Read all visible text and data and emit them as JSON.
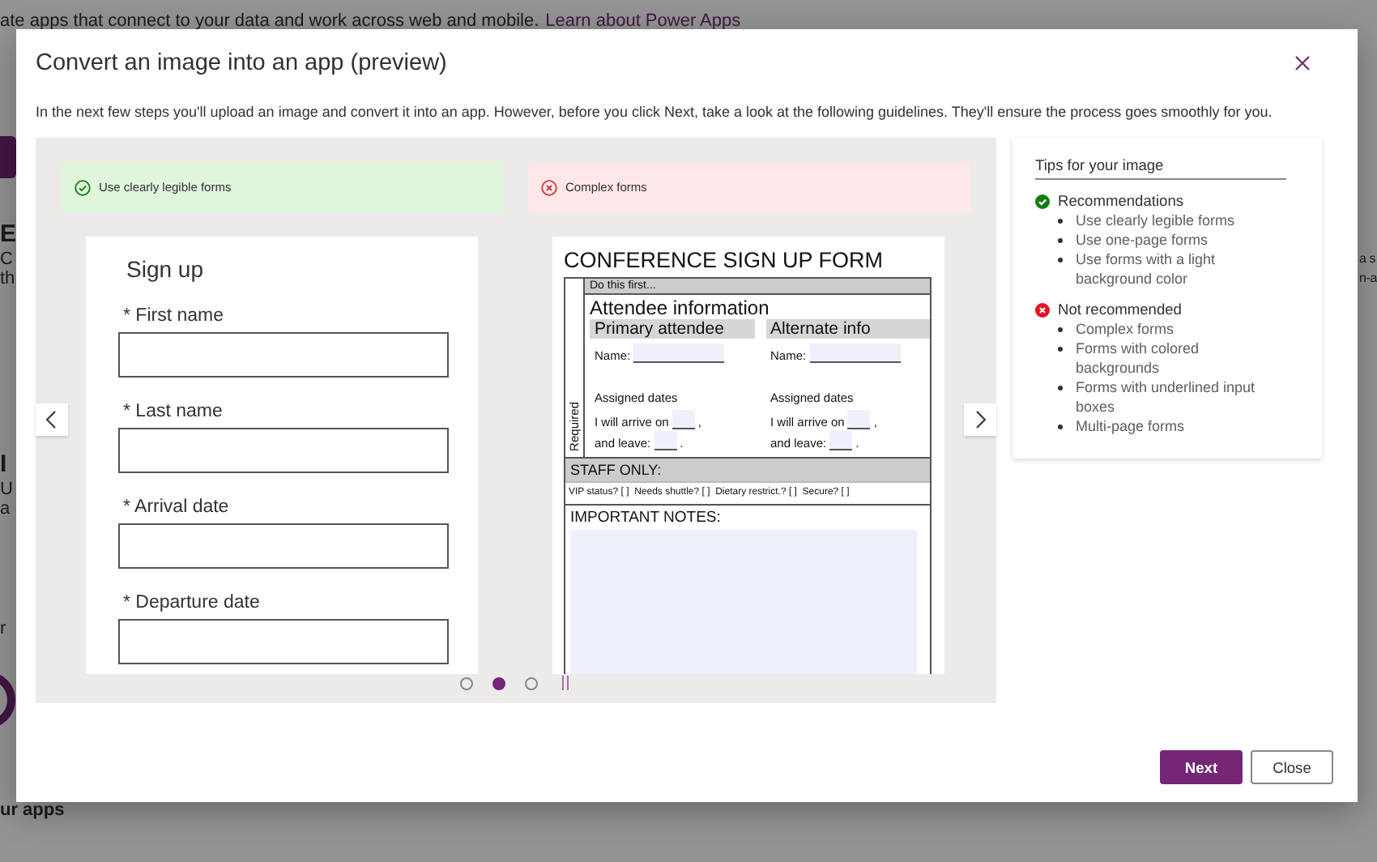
{
  "background": {
    "intro": "ate apps that connect to your data and work across web and mobile.",
    "link": "Learn about Power Apps",
    "left_fragments": [
      {
        "text": "E",
        "kind": "heading"
      },
      {
        "text": "C",
        "kind": "body"
      },
      {
        "text": "th",
        "kind": "body"
      },
      {
        "text": "I",
        "kind": "heading"
      },
      {
        "text": "U",
        "kind": "body"
      },
      {
        "text": "a",
        "kind": "body"
      },
      {
        "text": "r",
        "kind": "body"
      }
    ],
    "right_fragments": [
      "a s",
      "n-a"
    ],
    "footer": "ur apps"
  },
  "dialog": {
    "title": "Convert an image into an app (preview)",
    "description": "In the next few steps you'll upload an image and convert it into an app. However, before you click Next, take a look at the following guidelines. They'll ensure the process goes smoothly for you.",
    "examples": [
      {
        "kind": "good",
        "label": "Use clearly legible forms",
        "form": {
          "title": "Sign up",
          "fields": [
            "* First name",
            "* Last name",
            "* Arrival date",
            "* Departure date"
          ]
        }
      },
      {
        "kind": "bad",
        "label": "Complex forms",
        "form": {
          "title": "CONFERENCE SIGN UP FORM",
          "side_label": "Required",
          "banner": "Do this first...",
          "section": "Attendee information",
          "columns": [
            {
              "heading": "Primary attendee",
              "name_label": "Name:",
              "dates_heading": "Assigned dates",
              "arrive": "I will arrive on",
              "arrive_end": ",",
              "leave": "and leave:",
              "leave_end": "."
            },
            {
              "heading": "Alternate info",
              "name_label": "Name:",
              "dates_heading": "Assigned dates",
              "arrive": "I will arrive on",
              "arrive_end": ",",
              "leave": "and leave:",
              "leave_end": "."
            }
          ],
          "staff_heading": "STAFF ONLY:",
          "staff_items": "VIP status? [ ]  Needs shuttle? [ ]  Dietary restrict.? [ ]  Secure? [ ]",
          "notes_heading": "IMPORTANT NOTES:"
        }
      }
    ],
    "pager": [
      {
        "selected": false
      },
      {
        "selected": true
      },
      {
        "selected": false
      }
    ],
    "tips": {
      "title": "Tips for your image",
      "groups": [
        {
          "kind": "recommended",
          "heading": "Recommendations",
          "items": [
            "Use clearly legible forms",
            "Use one-page forms",
            "Use forms with a light background color"
          ]
        },
        {
          "kind": "not_recommended",
          "heading": "Not recommended",
          "items": [
            "Complex forms",
            "Forms with colored backgrounds",
            "Forms with underlined input boxes",
            "Multi-page forms"
          ]
        }
      ]
    },
    "buttons": [
      {
        "label": "Next",
        "kind": "primary"
      },
      {
        "label": "Close",
        "kind": "secondary"
      }
    ]
  }
}
